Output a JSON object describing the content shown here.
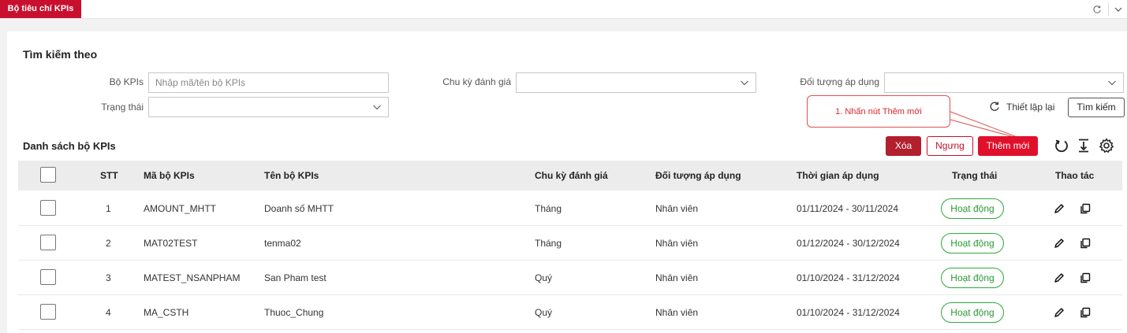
{
  "tabs": [
    {
      "label": "Bộ tiêu chí KPIs",
      "active": true
    }
  ],
  "colors": {
    "brand": "#c8102e",
    "add_button": "#e0102b",
    "delete_button": "#b21f2d",
    "status_active": "#2eaa3c"
  },
  "search": {
    "title": "Tìm kiếm theo",
    "kpi_set_label": "Bộ KPIs",
    "kpi_set_placeholder": "Nhập mã/tên bộ KPIs",
    "kpi_set_value": "",
    "cycle_label": "Chu kỳ đánh giá",
    "cycle_value": "",
    "target_label": "Đối tượng áp dụng",
    "target_value": "",
    "status_label": "Trạng thái",
    "status_value": "",
    "reset_label": "Thiết lập lại",
    "search_label": "Tìm kiếm"
  },
  "callout": {
    "text": "1. Nhấn nút Thêm mới"
  },
  "list": {
    "title": "Danh sách bộ KPIs",
    "delete_label": "Xóa",
    "stop_label": "Ngưng",
    "add_label": "Thêm mới",
    "tool_icons": [
      "refresh-icon",
      "export-icon",
      "settings-icon"
    ]
  },
  "table": {
    "headers": {
      "stt": "STT",
      "code": "Mã bộ KPIs",
      "name": "Tên bộ KPIs",
      "cycle": "Chu kỳ đánh giá",
      "target": "Đối tượng áp dụng",
      "period": "Thời gian áp dụng",
      "status": "Trạng thái",
      "actions": "Thao tác"
    },
    "rows": [
      {
        "stt": "1",
        "code": "AMOUNT_MHTT",
        "name": "Doanh số MHTT",
        "cycle": "Tháng",
        "target": "Nhân viên",
        "period": "01/11/2024 - 30/11/2024",
        "status": "Hoạt động"
      },
      {
        "stt": "2",
        "code": "MAT02TEST",
        "name": "tenma02",
        "cycle": "Tháng",
        "target": "Nhân viên",
        "period": "01/12/2024 - 30/12/2024",
        "status": "Hoạt động"
      },
      {
        "stt": "3",
        "code": "MATEST_NSANPHAM",
        "name": "San Pham test",
        "cycle": "Quý",
        "target": "Nhân viên",
        "period": "01/10/2024 - 31/12/2024",
        "status": "Hoạt động"
      },
      {
        "stt": "4",
        "code": "MA_CSTH",
        "name": "Thuoc_Chung",
        "cycle": "Quý",
        "target": "Nhân viên",
        "period": "01/10/2024 - 31/12/2024",
        "status": "Hoạt động"
      }
    ]
  }
}
